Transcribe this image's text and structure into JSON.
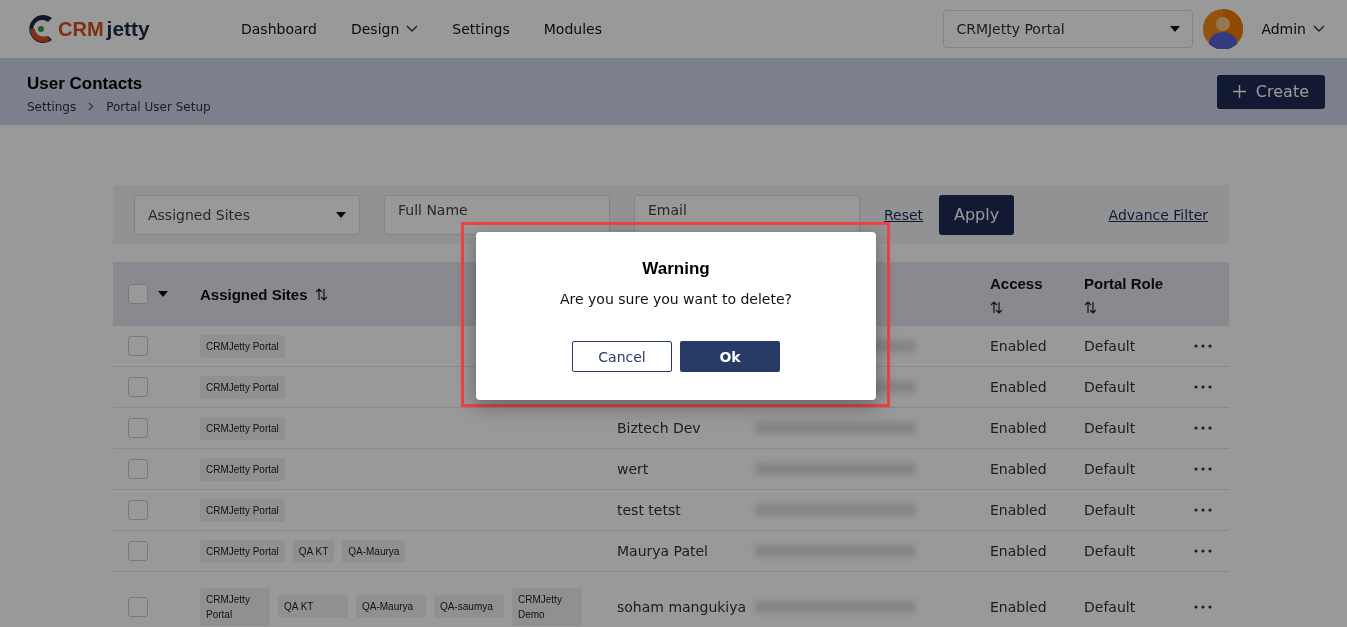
{
  "logo": {
    "part_1": "CRM",
    "part_2": "jetty"
  },
  "nav": [
    {
      "label": "Dashboard",
      "dropdown": false
    },
    {
      "label": "Design",
      "dropdown": true
    },
    {
      "label": "Settings",
      "dropdown": false
    },
    {
      "label": "Modules",
      "dropdown": false
    }
  ],
  "portal_select": {
    "value": "CRMJetty Portal"
  },
  "user": {
    "name": "Admin"
  },
  "page": {
    "title": "User Contacts",
    "breadcrumb": [
      "Settings",
      "Portal User Setup"
    ],
    "create_button": "Create"
  },
  "filters": {
    "assigned_sites": {
      "placeholder": "Assigned Sites"
    },
    "full_name": {
      "placeholder": "Full Name"
    },
    "email": {
      "placeholder": "Email"
    },
    "reset": "Reset",
    "apply": "Apply",
    "advance_filter": "Advance Filter"
  },
  "table": {
    "select_all_checked": false,
    "columns": [
      {
        "label": "Assigned Sites"
      },
      {
        "label": "Access"
      },
      {
        "label": "Portal Role"
      }
    ],
    "rows": [
      {
        "checked": false,
        "sites": [
          "CRMJetty Portal"
        ],
        "access": "Enabled",
        "role": "Default"
      },
      {
        "checked": false,
        "sites": [
          "CRMJetty Portal"
        ],
        "access": "Enabled",
        "role": "Default"
      },
      {
        "checked": false,
        "sites": [
          "CRMJetty Portal"
        ],
        "name": "Biztech Dev",
        "access": "Enabled",
        "role": "Default"
      },
      {
        "checked": false,
        "sites": [
          "CRMJetty Portal"
        ],
        "name": "wert",
        "access": "Enabled",
        "role": "Default"
      },
      {
        "checked": false,
        "sites": [
          "CRMJetty Portal"
        ],
        "name": "test tetst",
        "access": "Enabled",
        "role": "Default"
      },
      {
        "checked": false,
        "sites": [
          "CRMJetty Portal",
          "QA KT",
          "QA-Maurya"
        ],
        "name": "Maurya Patel",
        "access": "Enabled",
        "role": "Default"
      },
      {
        "checked": false,
        "sites": [
          "CRMJetty Portal",
          "QA KT",
          "QA-Maurya",
          "QA-saumya",
          "CRMJetty Demo"
        ],
        "name": "soham mangukiya",
        "access": "Enabled",
        "role": "Default"
      }
    ]
  },
  "dialog": {
    "title": "Warning",
    "message": "Are you sure you want to delete?",
    "cancel": "Cancel",
    "ok": "Ok"
  }
}
